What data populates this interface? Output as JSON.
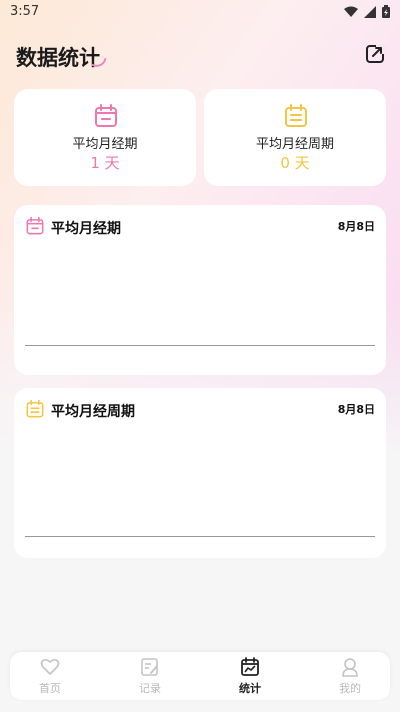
{
  "status_bar": {
    "time": "3:57"
  },
  "header": {
    "title": "数据统计"
  },
  "stats": [
    {
      "label": "平均月经期",
      "value": "1 天",
      "color": "#ef77b0"
    },
    {
      "label": "平均月经周期",
      "value": "0 天",
      "color": "#f4c542"
    }
  ],
  "charts": [
    {
      "title": "平均月经期",
      "date": "8月8日",
      "color": "#ef77b0"
    },
    {
      "title": "平均月经周期",
      "date": "8月8日",
      "color": "#f4c542"
    }
  ],
  "tabs": [
    {
      "label": "首页",
      "icon": "heart-icon",
      "active": false
    },
    {
      "label": "记录",
      "icon": "edit-note-icon",
      "active": false
    },
    {
      "label": "统计",
      "icon": "chart-calendar-icon",
      "active": true
    },
    {
      "label": "我的",
      "icon": "user-icon",
      "active": false
    }
  ]
}
